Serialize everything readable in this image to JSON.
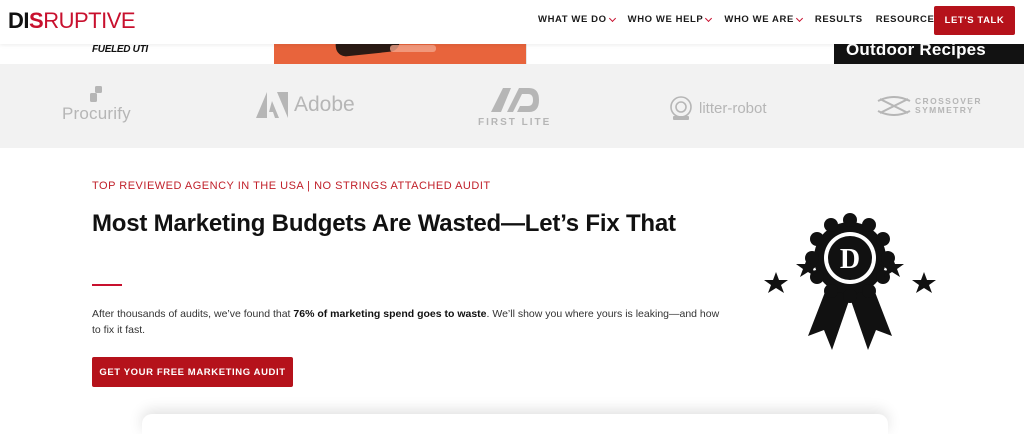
{
  "header": {
    "logo": {
      "part1": "DI",
      "part2": "S",
      "part3": "RUPTIVE"
    },
    "nav": [
      {
        "label": "WHAT WE DO",
        "dropdown": true
      },
      {
        "label": "WHO WE HELP",
        "dropdown": true
      },
      {
        "label": "WHO WE ARE",
        "dropdown": true
      },
      {
        "label": "RESULTS",
        "dropdown": false
      },
      {
        "label": "RESOURCES",
        "dropdown": true
      }
    ],
    "cta_label": "LET'S TALK"
  },
  "case_strip": {
    "card1_text": "FUELED UTI",
    "card4_text": "Outdoor Recipes"
  },
  "client_logos": [
    {
      "name": "Procurify",
      "icon": "procurify-logo-icon"
    },
    {
      "name": "Adobe",
      "icon": "adobe-logo-icon"
    },
    {
      "name": "FIRST LITE",
      "icon": "first-lite-logo-icon"
    },
    {
      "name": "litter-robot",
      "icon": "litter-robot-logo-icon"
    },
    {
      "name_line1": "CROSSOVER",
      "name_line2": "SYMMETRY",
      "icon": "crossover-symmetry-logo-icon"
    }
  ],
  "hero": {
    "eyebrow": "TOP REVIEWED AGENCY IN THE USA | NO STRINGS ATTACHED AUDIT",
    "headline": "Most Marketing Budgets Are Wasted—Let’s Fix That",
    "body_pre": "After thousands of audits, we’ve found that ",
    "body_bold": "76% of marketing spend goes to waste",
    "body_post": ". We’ll show you where yours is leaking—and how to fix it fast.",
    "cta_label": "GET YOUR FREE MARKETING AUDIT",
    "badge_letter": "D"
  },
  "colors": {
    "brand_red": "#c8102e",
    "button_red": "#b5121b",
    "logo_gray": "#b6b6b6",
    "band_bg": "#f2f2f2"
  }
}
